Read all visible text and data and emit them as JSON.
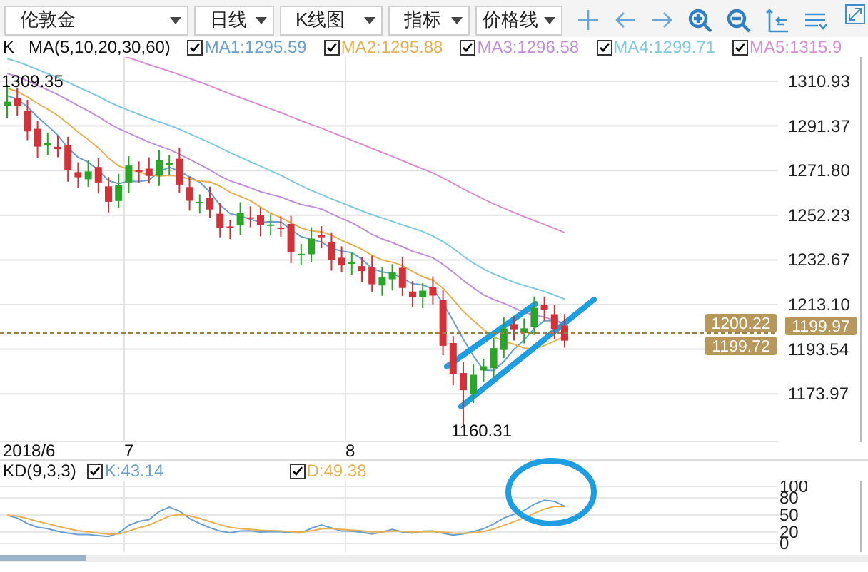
{
  "toolbar": {
    "dropdowns": [
      {
        "label": "伦敦金"
      },
      {
        "label": "日线"
      },
      {
        "label": "K线图"
      },
      {
        "label": "指标"
      },
      {
        "label": "价格线"
      }
    ]
  },
  "legend": {
    "type_label": "K",
    "ma_label": "MA(5,10,20,30,60)",
    "averages": [
      {
        "text": "MA1:1295.59",
        "checked": true,
        "color": "#6a9fcf"
      },
      {
        "text": "MA2:1295.88",
        "checked": true,
        "color": "#e8b050"
      },
      {
        "text": "MA3:1296.58",
        "checked": true,
        "color": "#c08fd8"
      },
      {
        "text": "MA4:1299.71",
        "checked": true,
        "color": "#7fc8e0"
      },
      {
        "text": "MA5:1315.9",
        "checked": true,
        "color": "#d98fcf"
      }
    ]
  },
  "price_axis": {
    "labels": [
      "1310.93",
      "1291.37",
      "1271.80",
      "1252.23",
      "1232.67",
      "1213.10",
      "1193.54",
      "1173.97"
    ]
  },
  "price_chart": {
    "high_label": "1309.35",
    "low_label": "1160.31",
    "tags": [
      {
        "text": "1200.22",
        "kind": "inner"
      },
      {
        "text": "1199.72",
        "kind": "inner"
      },
      {
        "text": "1199.97",
        "kind": "axis"
      }
    ]
  },
  "date_axis": {
    "labels": [
      "2018/6",
      "7",
      "8"
    ]
  },
  "kd": {
    "label": "KD(9,3,3)",
    "lines": [
      {
        "text": "K:43.14",
        "checked": true,
        "color": "#6a9fcf"
      },
      {
        "text": "D:49.38",
        "checked": true,
        "color": "#e8b050"
      }
    ],
    "axis_labels": [
      "100",
      "80",
      "50",
      "20",
      "0"
    ]
  }
}
